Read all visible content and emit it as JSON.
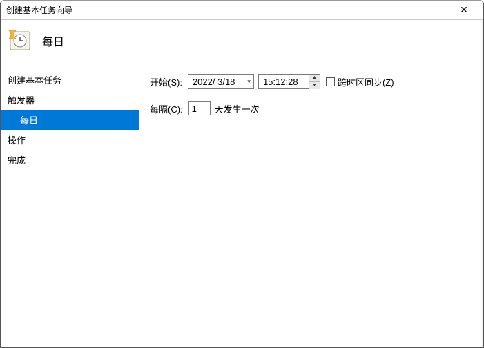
{
  "window": {
    "title": "创建基本任务向导",
    "close_glyph": "✕"
  },
  "header": {
    "title": "每日"
  },
  "sidebar": {
    "items": [
      {
        "label": "创建基本任务",
        "child": false,
        "selected": false
      },
      {
        "label": "触发器",
        "child": false,
        "selected": false
      },
      {
        "label": "每日",
        "child": true,
        "selected": true
      },
      {
        "label": "操作",
        "child": false,
        "selected": false
      },
      {
        "label": "完成",
        "child": false,
        "selected": false
      }
    ]
  },
  "main": {
    "start_label": "开始(S):",
    "date_value": "2022/ 3/18",
    "time_value": "15:12:28",
    "timezone_checkbox_label": "跨时区同步(Z)",
    "timezone_checked": false,
    "interval_label": "每隔(C):",
    "interval_value": "1",
    "interval_suffix": "天发生一次"
  }
}
